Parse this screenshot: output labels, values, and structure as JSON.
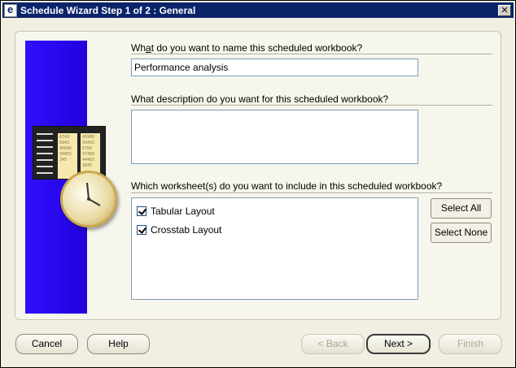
{
  "window": {
    "title": "Schedule Wizard Step 1 of 2 : General",
    "close_glyph": "✕"
  },
  "questions": {
    "name_label_pre": "Wh",
    "name_label_key": "a",
    "name_label_post": "t do you want to name this scheduled workbook?",
    "name_value": "Performance analysis",
    "desc_label": "What description do you want for this scheduled workbook?",
    "desc_value": "",
    "sheets_label": "Which worksheet(s) do you want to include in this scheduled workbook?"
  },
  "worksheets": [
    {
      "label": "Tabular Layout",
      "checked": true
    },
    {
      "label": "Crosstab Layout",
      "checked": true
    }
  ],
  "side_buttons": {
    "select_all": "Select All",
    "select_none": "Select None"
  },
  "bottom_buttons": {
    "cancel": "Cancel",
    "help": "Help",
    "back": "< Back",
    "next": "Next >",
    "finish": "Finish"
  },
  "art": {
    "sheet_col1": [
      "6749",
      "6843",
      "46686",
      "34855",
      "345"
    ],
    "sheet_col2": [
      "45906",
      "56493",
      "5789",
      "57389",
      "44483",
      "3645"
    ]
  },
  "colors": {
    "titlebar": "#0a246a",
    "banner": "#2200dd"
  }
}
